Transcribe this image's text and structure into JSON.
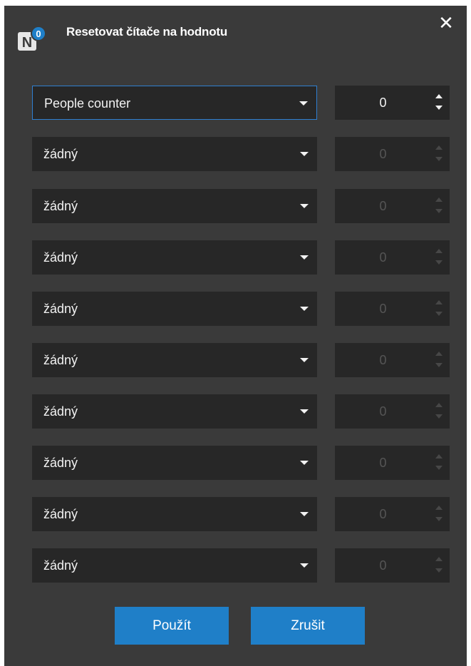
{
  "dialog": {
    "title": "Resetovat čítače na hodnotu",
    "app_badge": "0",
    "app_letter": "N",
    "close_glyph": "✕"
  },
  "rows": [
    {
      "counter": "People counter",
      "value": "0",
      "enabled": true
    },
    {
      "counter": "žádný",
      "value": "0",
      "enabled": false
    },
    {
      "counter": "žádný",
      "value": "0",
      "enabled": false
    },
    {
      "counter": "žádný",
      "value": "0",
      "enabled": false
    },
    {
      "counter": "žádný",
      "value": "0",
      "enabled": false
    },
    {
      "counter": "žádný",
      "value": "0",
      "enabled": false
    },
    {
      "counter": "žádný",
      "value": "0",
      "enabled": false
    },
    {
      "counter": "žádný",
      "value": "0",
      "enabled": false
    },
    {
      "counter": "žádný",
      "value": "0",
      "enabled": false
    },
    {
      "counter": "žádný",
      "value": "0",
      "enabled": false
    }
  ],
  "buttons": {
    "apply": "Použít",
    "cancel": "Zrušit"
  },
  "colors": {
    "background": "#3a3a3a",
    "field": "#272727",
    "accent": "#1f7fc8",
    "focus_border": "#2f7fd1"
  }
}
